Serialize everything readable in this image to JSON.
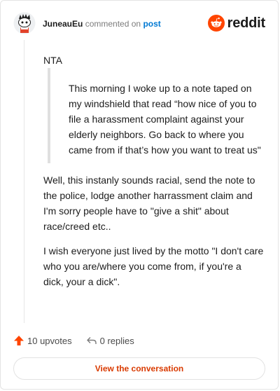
{
  "header": {
    "author": "JuneauEu",
    "action": "commented on",
    "target": "post",
    "brand": "reddit"
  },
  "comment": {
    "opening": "NTA",
    "quote": "This morning I woke up to a note taped on my windshield that read “how nice of you to file a harassment complaint against your elderly neighbors. Go back to where you came from if that’s how you want to treat us\"",
    "paragraph2": "Well, this instanly sounds racial, send the note to the police, lodge another harrassment claim and I'm sorry people have to \"give a shit\" about race/creed etc..",
    "paragraph3": "I wish everyone just lived by the motto \"I don't care who you are/where you come from, if you're a dick, your a dick\"."
  },
  "footer": {
    "upvotes": "10 upvotes",
    "replies": "0 replies",
    "cta": "View the conversation"
  },
  "colors": {
    "accent": "#ff4500",
    "link": "#0079d3",
    "cta_text": "#d93a00"
  }
}
